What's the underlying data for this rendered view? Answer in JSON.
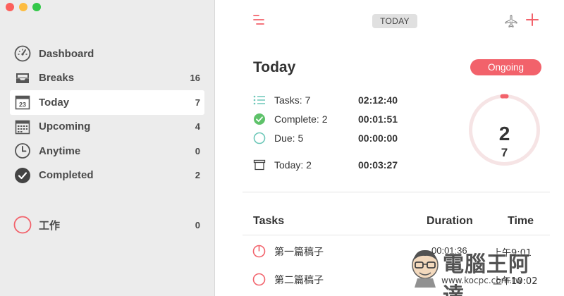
{
  "window": {
    "controls": [
      "close",
      "minimize",
      "zoom"
    ]
  },
  "sidebar": {
    "items": [
      {
        "label": "Dashboard",
        "count": "",
        "icon": "dashboard-gauge-icon"
      },
      {
        "label": "Breaks",
        "count": "16",
        "icon": "inbox-tray-icon"
      },
      {
        "label": "Today",
        "count": "7",
        "icon": "calendar-23-icon",
        "active": true,
        "calendar_day": "23"
      },
      {
        "label": "Upcoming",
        "count": "4",
        "icon": "calendar-grid-icon"
      },
      {
        "label": "Anytime",
        "count": "0",
        "icon": "clock-icon"
      },
      {
        "label": "Completed",
        "count": "2",
        "icon": "check-circle-icon"
      }
    ],
    "projects": [
      {
        "label": "工作",
        "count": "0",
        "icon": "red-circle-icon"
      }
    ]
  },
  "toolbar": {
    "menu_icon": "list-lines-icon",
    "view_label": "TODAY",
    "plane_icon": "airplane-icon",
    "add_icon": "plus-icon"
  },
  "main": {
    "title": "Today",
    "status_button": "Ongoing",
    "stats": [
      {
        "label": "Tasks: 7",
        "time": "02:12:40",
        "icon": "list-icon"
      },
      {
        "label": "Complete: 2",
        "time": "00:01:51",
        "icon": "green-check-icon"
      },
      {
        "label": "Due: 5",
        "time": "00:00:00",
        "icon": "teal-circle-icon"
      },
      {
        "label": "Today: 2",
        "time": "00:03:27",
        "icon": "archive-box-icon"
      }
    ],
    "progress": {
      "completed": "2",
      "total": "7",
      "fraction": 0.02
    },
    "table": {
      "headers": {
        "tasks": "Tasks",
        "duration": "Duration",
        "time": "Time"
      },
      "rows": [
        {
          "name": "第一篇稿子",
          "duration": "00:01:36",
          "time": "上午9:01"
        },
        {
          "name": "第二篇稿子",
          "duration": "",
          "time": "上午10:02"
        }
      ]
    }
  },
  "watermark": {
    "text": "電腦王阿達",
    "url": "www.kocpc.com.tw"
  },
  "colors": {
    "accent": "#f2626b",
    "sidebar_bg": "#ececec",
    "ring_track": "#f6e4e5",
    "check_green": "#5ec26a",
    "due_teal": "#6cc7b8"
  }
}
